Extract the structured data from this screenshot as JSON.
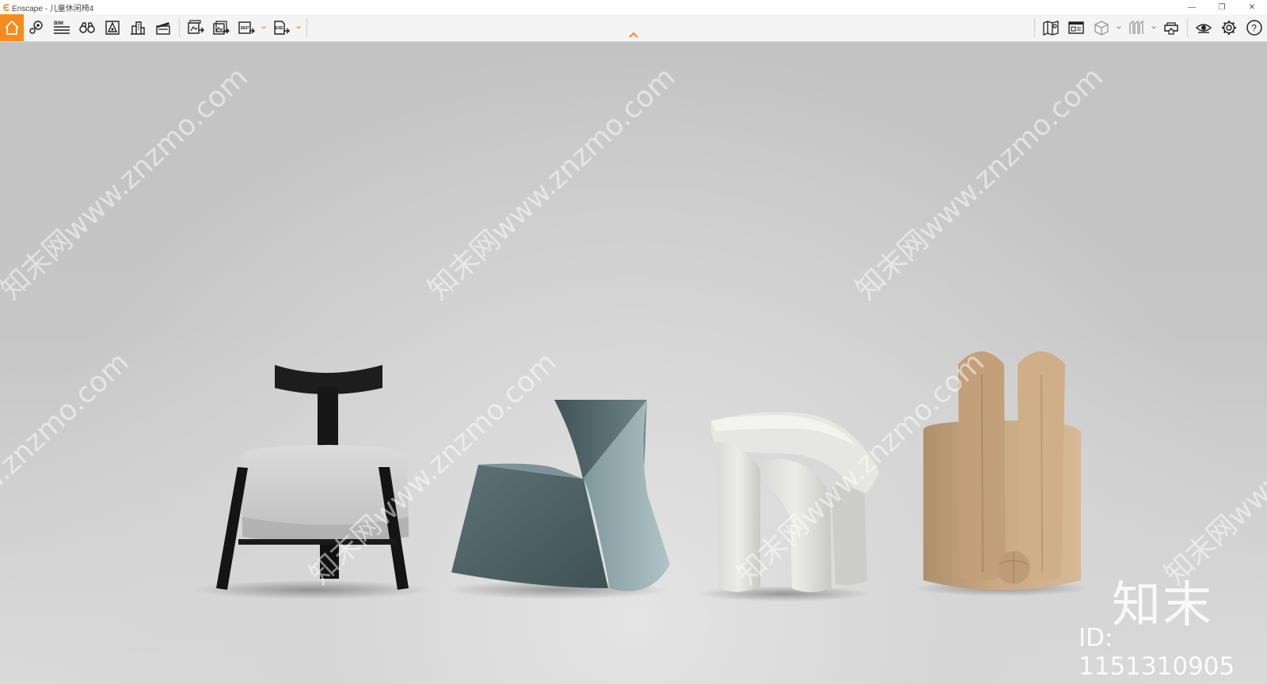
{
  "window": {
    "title": "Enscape - 儿童休闲椅4",
    "minimize_glyph": "—",
    "restore_glyph": "❐",
    "close_glyph": "✕"
  },
  "toolbar": {
    "left_buttons": [
      {
        "name": "home-icon",
        "label": "Home"
      },
      {
        "name": "location-pin-icon",
        "label": "Views"
      },
      {
        "name": "bim-icon",
        "label": "BIM"
      },
      {
        "name": "binoculars-icon",
        "label": "Walk"
      },
      {
        "name": "asset-library-icon",
        "label": "Asset Library"
      },
      {
        "name": "city-buildings-icon",
        "label": "Site"
      },
      {
        "name": "clapperboard-icon",
        "label": "Video Editor"
      },
      {
        "name": "render-screenshot-icon",
        "label": "Render"
      },
      {
        "name": "batch-render-icon",
        "label": "Batch Render"
      },
      {
        "name": "panorama-360-icon",
        "label": "360"
      },
      {
        "name": "export-exe-icon",
        "label": "EXE"
      }
    ],
    "bim_text": "BIM",
    "pano_text": "360°",
    "exe_text": "EXE",
    "right_buttons": [
      {
        "name": "map-icon"
      },
      {
        "name": "web-standalone-icon"
      },
      {
        "name": "cube-view-icon"
      },
      {
        "name": "orthographic-icon"
      },
      {
        "name": "vr-headset-icon"
      },
      {
        "name": "eye-visual-settings-icon"
      },
      {
        "name": "gear-icon"
      },
      {
        "name": "help-icon"
      }
    ],
    "help_glyph": "?",
    "accent": "#f68b1f"
  },
  "viewport": {
    "watermark_text": "知末网www.znzmo.com",
    "brand": "知末",
    "id_text": "ID: 1151310905",
    "objects": [
      "black-wood-chair",
      "slate-rocking-chair",
      "white-elephant-stool",
      "tan-bunny-chair"
    ]
  }
}
